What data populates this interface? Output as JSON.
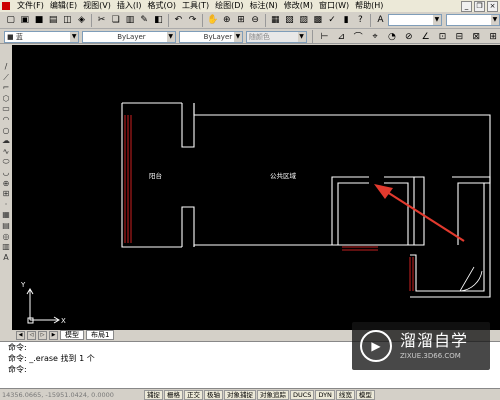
{
  "menu": {
    "items": [
      "文件(F)",
      "编辑(E)",
      "视图(V)",
      "插入(I)",
      "格式(O)",
      "工具(T)",
      "绘图(D)",
      "标注(N)",
      "修改(M)",
      "窗口(W)",
      "帮助(H)"
    ]
  },
  "toolbar2": {
    "layer_value": "■ 蓝",
    "linetype_value": "ByLayer",
    "lineweight_value": "ByLayer",
    "plotstyle_value": "随颜色"
  },
  "drawing": {
    "label_balcony": "阳台",
    "label_public_area": "公共区域",
    "axis_y": "Y",
    "axis_x": "X"
  },
  "tabs": {
    "model": "模型",
    "layout1": "布局1"
  },
  "command": {
    "line1": "命令:",
    "line2": "命令: _.erase 找到 1 个",
    "line3": "命令:"
  },
  "status": {
    "coords": "14356.0665, -15951.0424, 0.0000",
    "snap": "捕捉",
    "grid": "栅格",
    "ortho": "正交",
    "polar": "极轴",
    "osnap": "对象捕捉",
    "otrack": "对象追踪",
    "ducs": "DUCS",
    "dyn": "DYN",
    "lwt": "线宽",
    "model": "模型"
  },
  "watermark": {
    "title": "溜溜自学",
    "url": "ZIXUE.3D66.COM"
  },
  "colors": {
    "canvas": "#000000",
    "wall": "#ffffff",
    "red_line": "#ff2a2a",
    "arrow": "#e23a2e"
  }
}
